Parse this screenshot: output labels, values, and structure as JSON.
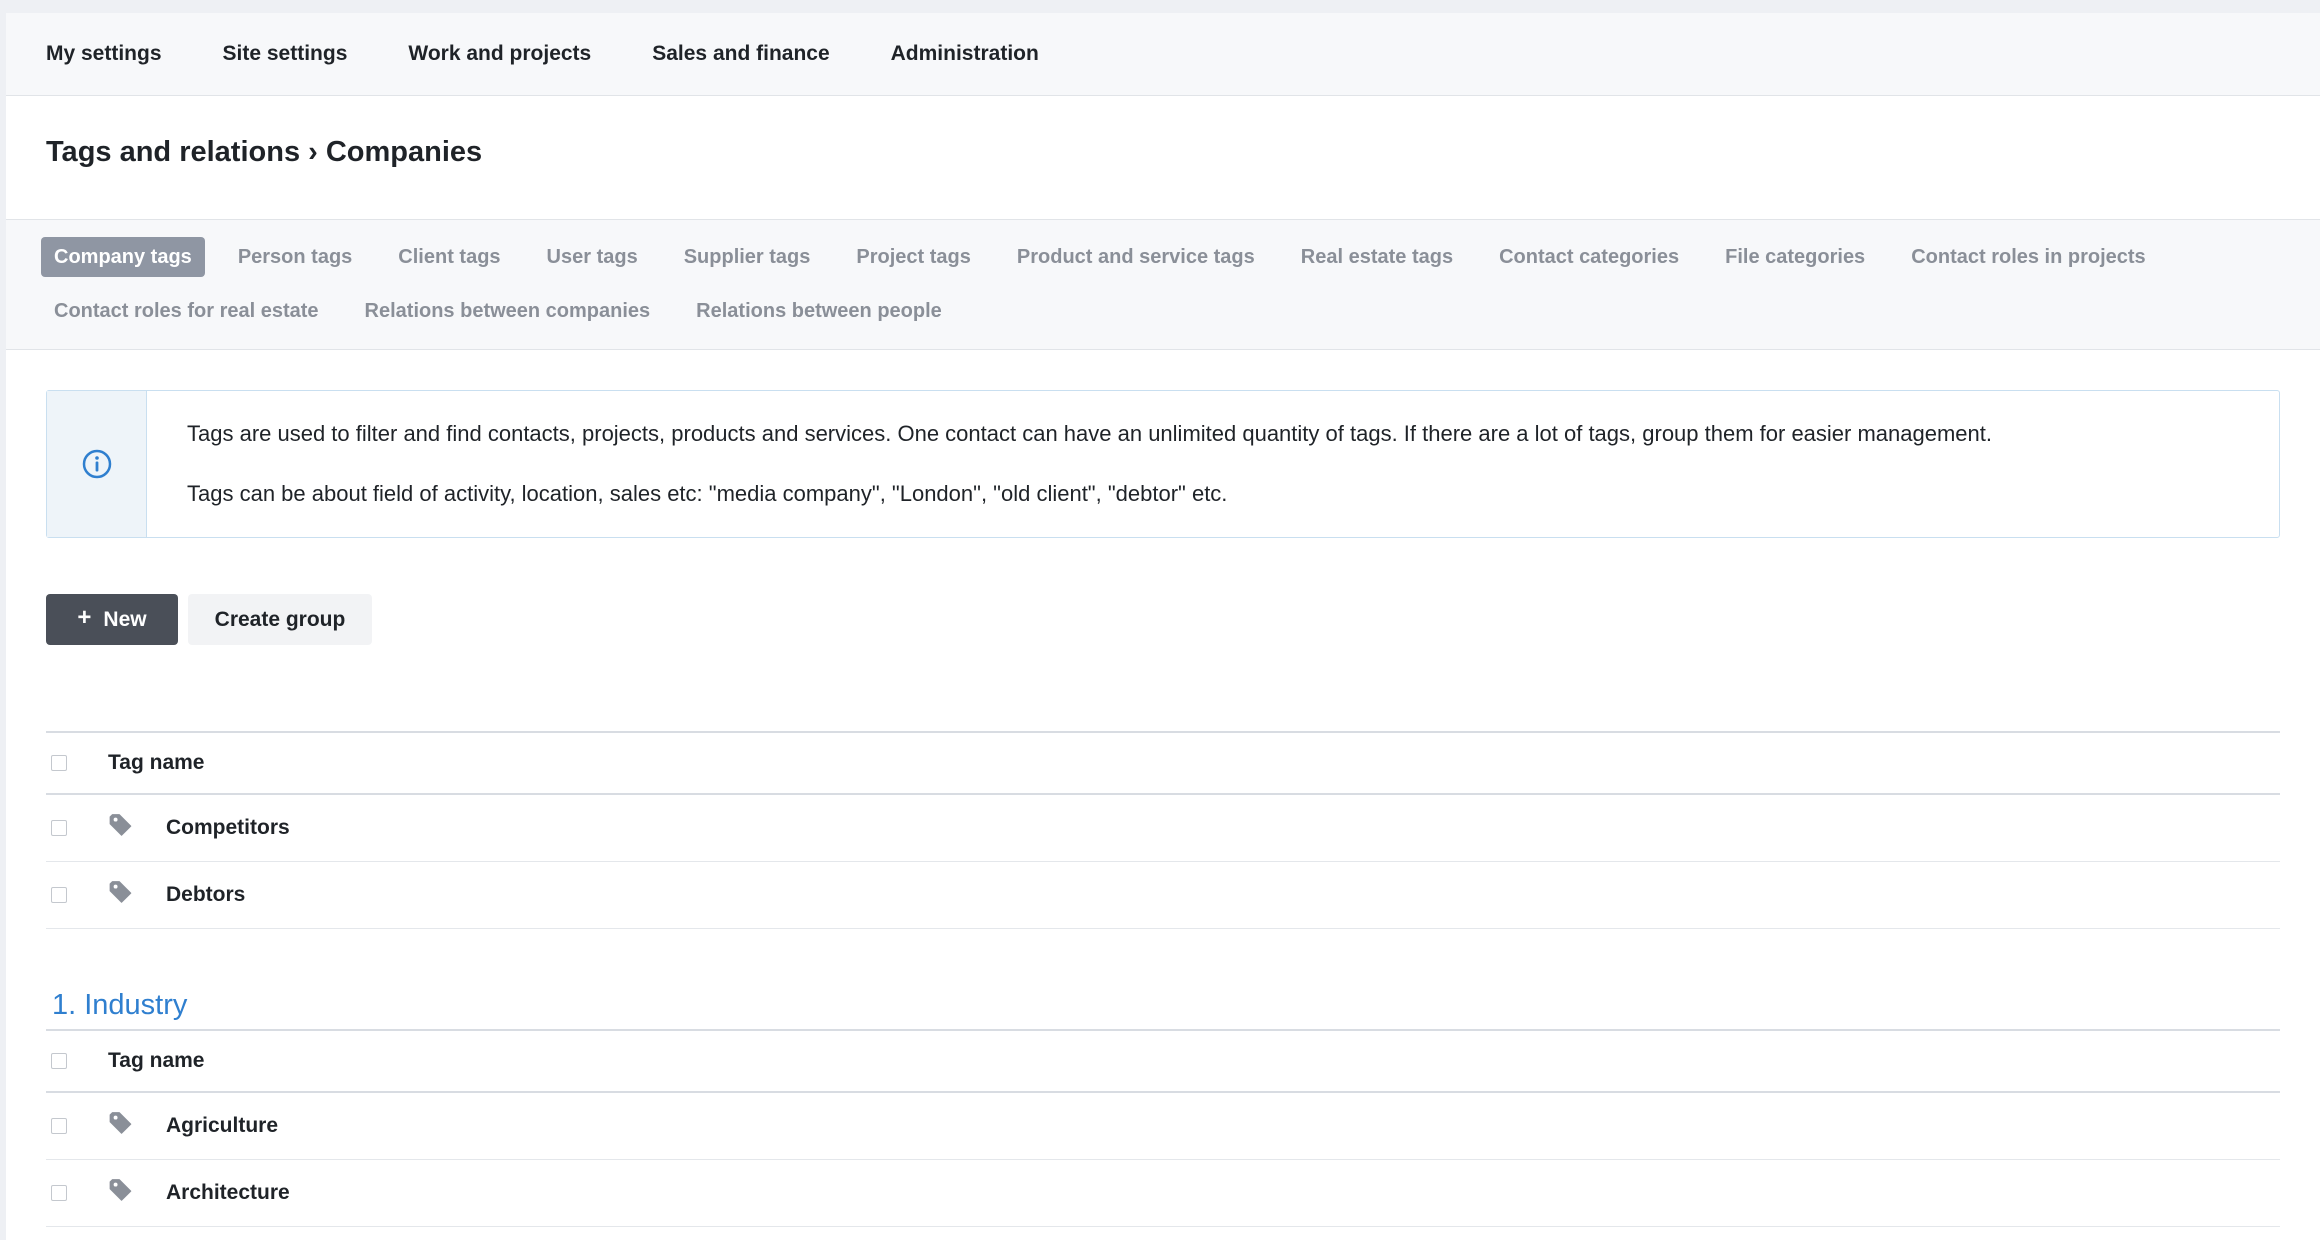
{
  "topnav": {
    "items": [
      "My settings",
      "Site settings",
      "Work and projects",
      "Sales and finance",
      "Administration"
    ]
  },
  "page": {
    "title": "Tags and relations › Companies"
  },
  "tabs": {
    "row1": [
      "Company tags",
      "Person tags",
      "Client tags",
      "User tags",
      "Supplier tags",
      "Project tags",
      "Product and service tags",
      "Real estate tags",
      "Contact categories",
      "File categories",
      "Contact roles in projects"
    ],
    "row2": [
      "Contact roles for real estate",
      "Relations between companies",
      "Relations between people"
    ],
    "active": "Company tags"
  },
  "info": {
    "icon": "info-circle-icon",
    "line1": "Tags are used to filter and find contacts, projects, products and services. One contact can have an unlimited quantity of tags. If there are a lot of tags, group them for easier management.",
    "line2": "Tags can be about field of activity, location, sales etc: \"media company\", \"London\", \"old client\", \"debtor\" etc."
  },
  "actions": {
    "new_label": "New",
    "create_group_label": "Create group"
  },
  "ungrouped": {
    "header": "Tag name",
    "rows": [
      "Competitors",
      "Debtors"
    ]
  },
  "groups": [
    {
      "title": "1. Industry",
      "header": "Tag name",
      "rows": [
        "Agriculture",
        "Architecture"
      ]
    }
  ],
  "colors": {
    "accent": "#2f7fcf",
    "active_tab": "#8f96a3",
    "primary_button": "#4a4f58"
  }
}
